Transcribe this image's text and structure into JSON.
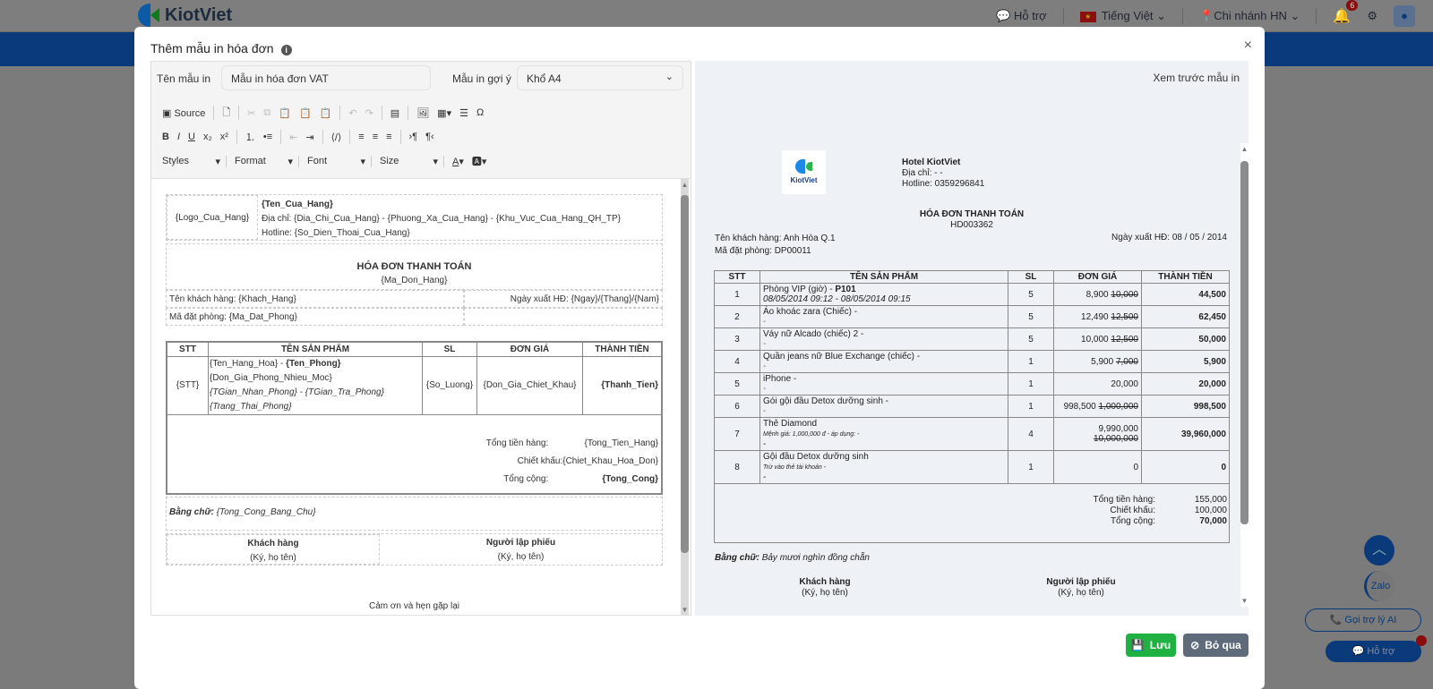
{
  "app": {
    "name": "KiotViet",
    "support": "Hỗ trợ",
    "language": "Tiếng Việt",
    "branch": "Chi nhánh HN",
    "notifications": "6"
  },
  "modal": {
    "title": "Thêm mẫu in hóa đơn",
    "close": "×"
  },
  "form": {
    "name_label": "Tên mẫu in",
    "name_value": "Mẫu in hóa đơn VAT",
    "suggest_label": "Mẫu in gợi ý",
    "suggest_value": "Khổ A4"
  },
  "toolbar": {
    "source": "Source",
    "styles": "Styles",
    "format": "Format",
    "font": "Font",
    "size": "Size"
  },
  "template": {
    "logo": "{Logo_Cua_Hang}",
    "store": "{Ten_Cua_Hang}",
    "address": "Địa chỉ: {Dia_Chi_Cua_Hang} - {Phuong_Xa_Cua_Hang} - {Khu_Vuc_Cua_Hang_QH_TP}",
    "hotline": "Hotline: {So_Dien_Thoai_Cua_Hang}",
    "title": "HÓA ĐƠN THANH TOÁN",
    "code": "{Ma_Don_Hang}",
    "customer": "Tên khách hàng: {Khach_Hang}",
    "date": "Ngày xuất HĐ: {Ngay}/{Thang}/{Nam}",
    "booking": "Mã đặt phòng: {Ma_Dat_Phong}",
    "headers": [
      "STT",
      "TÊN SẢN PHẨM",
      "SL",
      "ĐƠN GIÁ",
      "THÀNH TIỀN"
    ],
    "row": {
      "stt": "{STT}",
      "name": "{Ten_Hang_Hoa}",
      "room": "{Ten_Phong}",
      "line2": "{Don_Gia_Phong_Nhieu_Moc}",
      "line3": "{TGian_Nhan_Phong} - {TGian_Tra_Phong}",
      "line4": "{Trang_Thai_Phong}",
      "qty": "{So_Luong}",
      "price": "{Don_Gia_Chiet_Khau}",
      "total": "{Thanh_Tien}"
    },
    "sum_labels": [
      "Tổng tiền hàng:",
      "Chiết khấu:",
      "Tổng cộng:"
    ],
    "sum_values": [
      "{Tong_Tien_Hang}",
      "{Chiet_Khau_Hoa_Don}",
      "{Tong_Cong}"
    ],
    "words_label": "Bằng chữ:",
    "words": "{Tong_Cong_Bang_Chu}",
    "sign1": "Khách hàng",
    "sign2": "Người lập phiếu",
    "sign_note": "(Ký, họ tên)",
    "footer": "Cảm ơn và hẹn gặp lại"
  },
  "preview": {
    "title": "Xem trước mẫu in",
    "logo_text": "KiotViet",
    "store": "Hotel KiotViet",
    "address": "Địa chỉ: - -",
    "hotline": "Hotline: 0359296841",
    "doc_title": "HÓA ĐƠN THANH TOÁN",
    "code": "HD003362",
    "customer": "Tên khách hàng: Anh Hòa Q.1",
    "date": "Ngày xuất HĐ: 08 / 05 / 2014",
    "booking": "Mã đặt phòng: DP00011",
    "headers": [
      "STT",
      "TÊN SẢN PHẨM",
      "SL",
      "ĐƠN GIÁ",
      "THÀNH TIỀN"
    ],
    "rows": [
      {
        "stt": "1",
        "name": "Phòng VIP (giờ) - ",
        "bold": "P101",
        "sub": "08/05/2014 09:12 - 08/05/2014 09:15",
        "subtype": "italic",
        "qty": "5",
        "price": "8,900",
        "old": "10,000",
        "total": "44,500"
      },
      {
        "stt": "2",
        "name": "Áo khoác zara (Chiếc) -",
        "sub": "-",
        "qty": "5",
        "price": "12,490",
        "old": "12,500",
        "total": "62,450"
      },
      {
        "stt": "3",
        "name": "Váy nữ Alcado (chiếc) 2 -",
        "sub": "-",
        "qty": "5",
        "price": "10,000",
        "old": "12,500",
        "total": "50,000"
      },
      {
        "stt": "4",
        "name": "Quần jeans nữ Blue Exchange (chiếc) -",
        "sub": "-",
        "qty": "1",
        "price": "5,900",
        "old": "7,000",
        "total": "5,900"
      },
      {
        "stt": "5",
        "name": "iPhone -",
        "sub": "-",
        "qty": "1",
        "price": "20,000",
        "old": "",
        "total": "20,000"
      },
      {
        "stt": "6",
        "name": "Gói gội đầu Detox dưỡng sinh -",
        "sub": "-",
        "qty": "1",
        "price": "998,500",
        "old": "1,000,000",
        "total": "998,500"
      },
      {
        "stt": "7",
        "name": "Thẻ Diamond",
        "sub": "Mệnh giá: 1,000,000 đ - áp dụng: -",
        "subtype": "small",
        "sub2": "-",
        "qty": "4",
        "price": "9,990,000",
        "old": "10,000,000",
        "total": "39,960,000"
      },
      {
        "stt": "8",
        "name": "Gội đầu Detox dưỡng sinh",
        "sub": "Trừ vào thẻ tài khoản -",
        "subtype": "small",
        "sub2": "-",
        "qty": "1",
        "price": "0",
        "old": "",
        "total": "0"
      }
    ],
    "sum_labels": [
      "Tổng tiền hàng:",
      "Chiết khấu:",
      "Tổng cộng:"
    ],
    "sum_values": [
      "155,000",
      "100,000",
      "70,000"
    ],
    "words_label": "Bằng chữ:",
    "words": "Bảy mươi nghìn đồng chẵn",
    "sign1": "Khách hàng",
    "sign2": "Người lập phiếu",
    "sign_note": "(Ký, họ tên)"
  },
  "buttons": {
    "save": "Lưu",
    "cancel": "Bỏ qua"
  },
  "floating": {
    "zalo": "Zalo",
    "ai": "Gọi trợ lý AI",
    "support": "Hỗ trợ"
  },
  "colors": {
    "save": "#1fb141",
    "cancel": "#5f6b7a",
    "brand": "#0a3a7a"
  }
}
